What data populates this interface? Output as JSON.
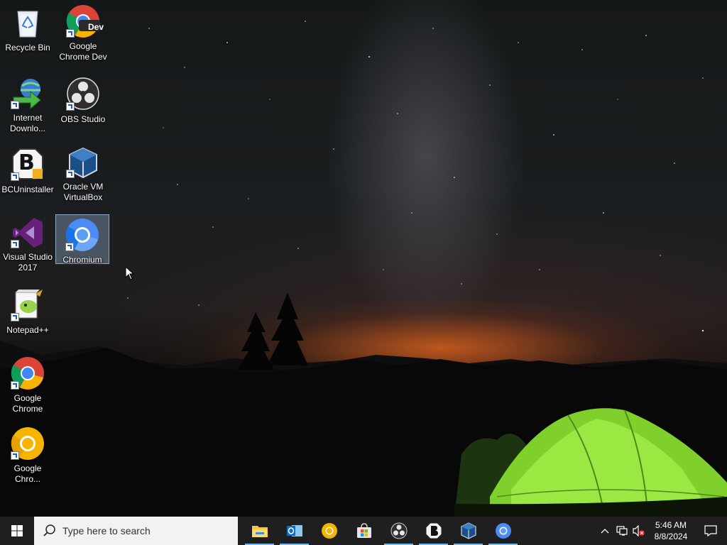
{
  "desktop": {
    "icons": [
      {
        "id": "recycle-bin",
        "label": "Recycle Bin",
        "icon": "recycle-bin-icon"
      },
      {
        "id": "google-chrome-dev",
        "label": "Google\nChrome Dev",
        "icon": "chrome-dev-icon",
        "badge": "Dev"
      },
      {
        "id": "internet-download-manager",
        "label": "Internet\nDownlo...",
        "icon": "internet-download-manager-icon"
      },
      {
        "id": "obs-studio",
        "label": "OBS Studio",
        "icon": "obs-studio-icon"
      },
      {
        "id": "bcuninstaller",
        "label": "BCUninstaller",
        "icon": "bcuninstaller-icon",
        "badge": "B"
      },
      {
        "id": "oracle-vm-virtualbox",
        "label": "Oracle VM\nVirtualBox",
        "icon": "virtualbox-icon"
      },
      {
        "id": "visual-studio-2017",
        "label": "Visual Studio\n2017",
        "icon": "visual-studio-icon"
      },
      {
        "id": "chromium",
        "label": "Chromium",
        "icon": "chromium-icon",
        "selected": true
      },
      {
        "id": "notepad-plus-plus",
        "label": "Notepad++",
        "icon": "notepad-plus-plus-icon"
      },
      {
        "id": "google-chrome",
        "label": "Google\nChrome",
        "icon": "chrome-icon"
      },
      {
        "id": "google-chrome-canary",
        "label": "Google\nChro...",
        "icon": "chrome-canary-icon"
      }
    ]
  },
  "taskbar": {
    "search_placeholder": "Type here to search",
    "apps": [
      {
        "id": "file-explorer",
        "icon": "file-explorer-icon",
        "running": true
      },
      {
        "id": "outlook",
        "icon": "outlook-icon",
        "running": true
      },
      {
        "id": "chrome-canary",
        "icon": "chrome-canary-icon",
        "running": false
      },
      {
        "id": "microsoft-store",
        "icon": "microsoft-store-icon",
        "running": false
      },
      {
        "id": "obs-studio",
        "icon": "obs-studio-icon",
        "running": true
      },
      {
        "id": "bcuninstaller",
        "icon": "bcuninstaller-icon",
        "running": true
      },
      {
        "id": "virtualbox",
        "icon": "virtualbox-icon",
        "running": true
      },
      {
        "id": "chromium",
        "icon": "chromium-icon",
        "running": true
      }
    ],
    "tray": {
      "icons": [
        "show-hidden-icons-icon",
        "network-icon",
        "volume-muted-icon"
      ]
    },
    "clock": {
      "time": "5:46 AM",
      "date": "8/8/2024"
    }
  },
  "colors": {
    "taskbar_bg": "#1f1f1f",
    "search_bg": "#f2f2f2",
    "selection": "#a0bee6",
    "running_indicator": "#76b9ed",
    "tent_green": "#8fe03a"
  }
}
